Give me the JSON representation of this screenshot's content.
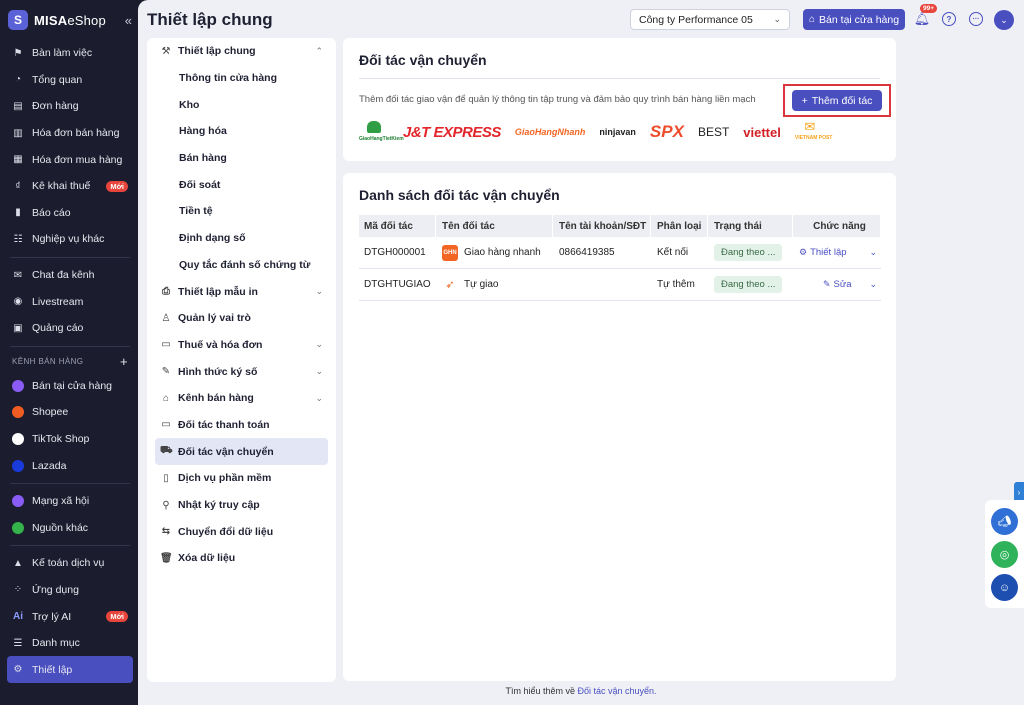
{
  "brand": {
    "name_bold": "MISA",
    "name_light": "eShop"
  },
  "sidebar": {
    "items": [
      {
        "label": "Bàn làm việc",
        "icon": "workspace-icon"
      },
      {
        "label": "Tổng quan",
        "icon": "dashboard-icon"
      },
      {
        "label": "Đơn hàng",
        "icon": "order-icon"
      },
      {
        "label": "Hóa đơn bán hàng",
        "icon": "sales-invoice-icon"
      },
      {
        "label": "Hóa đơn mua hàng",
        "icon": "purchase-invoice-icon"
      },
      {
        "label": "Kê khai thuế",
        "icon": "tax-icon",
        "badge": "Mới"
      },
      {
        "label": "Báo cáo",
        "icon": "report-icon"
      },
      {
        "label": "Nghiệp vụ khác",
        "icon": "other-icon"
      }
    ],
    "items2": [
      {
        "label": "Chat đa kênh",
        "icon": "chat-icon"
      },
      {
        "label": "Livestream",
        "icon": "livestream-icon"
      },
      {
        "label": "Quảng cáo",
        "icon": "ads-icon"
      }
    ],
    "sales_channels_header": "KÊNH BÁN HÀNG",
    "channels": [
      {
        "label": "Bán tại cửa hàng",
        "color": "#8a5cf6"
      },
      {
        "label": "Shopee",
        "color": "#f05d23"
      },
      {
        "label": "TikTok Shop",
        "color": "#ffffff"
      },
      {
        "label": "Lazada",
        "color": "#1a3bdc"
      }
    ],
    "items3": [
      {
        "label": "Mạng xã hội",
        "color": "#8a5cf6"
      },
      {
        "label": "Nguồn khác",
        "color": "#34b34a"
      }
    ],
    "items4": [
      {
        "label": "Kế toán dịch vụ",
        "icon": "accounting-icon"
      },
      {
        "label": "Ứng dụng",
        "icon": "apps-icon"
      },
      {
        "label": "Trợ lý AI",
        "icon": "ai-icon",
        "badge": "Mới"
      },
      {
        "label": "Danh mục",
        "icon": "list-icon"
      },
      {
        "label": "Thiết lập",
        "icon": "settings-icon"
      }
    ]
  },
  "header": {
    "title": "Thiết lập chung",
    "company": "Công ty Performance 05",
    "store_button": "Bán tại cửa hàng",
    "notif_count": "99+"
  },
  "settings_menu": {
    "general": "Thiết lập chung",
    "general_sub": [
      "Thông tin cửa hàng",
      "Kho",
      "Hàng hóa",
      "Bán hàng",
      "Đối soát",
      "Tiền tệ",
      "Định dạng số",
      "Quy tắc đánh số chứng từ"
    ],
    "print": "Thiết lập mẫu in",
    "roles": "Quản lý vai trò",
    "tax": "Thuế và hóa đơn",
    "sign": "Hình thức ký số",
    "channels": "Kênh bán hàng",
    "payment": "Đối tác thanh toán",
    "shipping": "Đối tác vận chuyển",
    "services": "Dịch vụ phần mềm",
    "log": "Nhật ký truy cập",
    "convert": "Chuyển đổi dữ liệu",
    "delete": "Xóa dữ liệu"
  },
  "partner_card": {
    "title": "Đối tác vận chuyển",
    "desc": "Thêm đối tác giao vận để quản lý thông tin tập trung và đảm bảo quy trình bán hàng liền mạch",
    "add_button": "Thêm đối tác",
    "logos": [
      "GiaoHangTietKiem",
      "J&T EXPRESS",
      "GiaoHangNhanh",
      "ninjavan",
      "SPX",
      "BEST",
      "viettel",
      "VIETNAM POST"
    ]
  },
  "list_card": {
    "title": "Danh sách đối tác vận chuyển",
    "columns": [
      "Mã đối tác",
      "Tên đối tác",
      "Tên tài khoản/SĐT",
      "Phân loại",
      "Trạng thái",
      "Chức năng"
    ],
    "rows": [
      {
        "code": "DTGH000001",
        "name": "Giao hàng nhanh",
        "account": "0866419385",
        "type": "Kết nối",
        "status": "Đang theo ...",
        "action": "Thiết lập"
      },
      {
        "code": "DTGHTUGIAO",
        "name": "Tự giao",
        "account": "",
        "type": "Tự thêm",
        "status": "Đang theo ...",
        "action": "Sửa"
      }
    ]
  },
  "footer": {
    "text": "Tìm hiểu thêm về ",
    "link": "Đối tác vận chuyển."
  }
}
